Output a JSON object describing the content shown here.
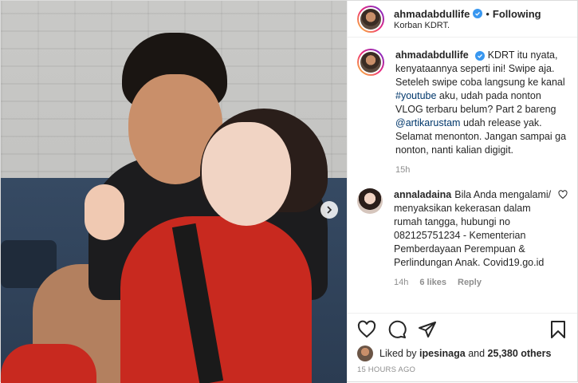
{
  "post": {
    "author": "ahmadabdullife",
    "separator": "•",
    "follow_status": "Following",
    "location": "Korban KDRT."
  },
  "caption": {
    "username": "ahmadabdullife",
    "text_before_hashtag": "KDRT itu nyata, kenyataannya seperti ini! Swipe aja. Seteleh swipe coba langsung ke kanal ",
    "hashtag": "#youtube",
    "text_before_mention": " aku, udah pada nonton VLOG terbaru belum? Part 2 bareng ",
    "mention": "@artikarustam",
    "text_after_mention": " udah release yak. Selamat menonton. Jangan sampai ga nonton, nanti kalian digigit.",
    "time": "15h"
  },
  "comments": [
    {
      "username": "annaladaina",
      "text": "Bila Anda mengalami/ menyaksikan kekerasan dalam rumah tangga, hubungi no 082125751234 - Kementerian Pemberdayaan Perempuan & Perlindungan Anak. Covid19.go.id",
      "time": "14h",
      "likes": "6 likes",
      "reply": "Reply"
    }
  ],
  "likes": {
    "prefix": "Liked by ",
    "user": "ipesinaga",
    "middle": " and ",
    "others": "25,380 others"
  },
  "timestamp": "15 HOURS AGO",
  "icons": [
    "chevron-right-icon",
    "verified-badge-icon",
    "heart-icon",
    "comment-icon",
    "share-icon",
    "bookmark-icon"
  ],
  "colors": {
    "accent": "#3897f0",
    "link": "#00376b",
    "muted": "#8e8e8e"
  }
}
